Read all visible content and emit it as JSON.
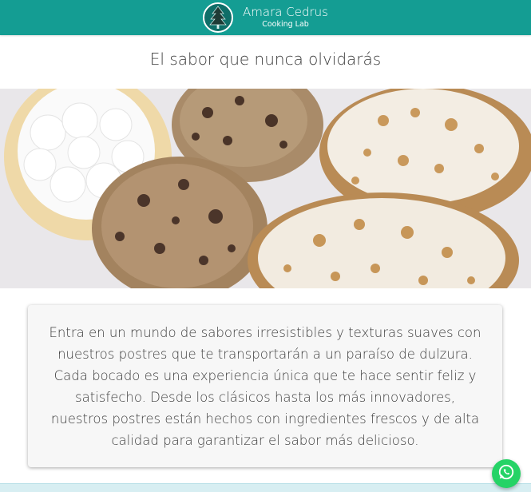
{
  "header": {
    "brand_name": "Amara Cedrus",
    "brand_subtitle": "Cooking Lab",
    "logo_icon": "cedar-tree-icon",
    "background_color": "#149d93"
  },
  "hero": {
    "title": "El sabor que nunca olvidarás",
    "image_subject": "pastries"
  },
  "intro": {
    "text": "Entra en un mundo de sabores irresistibles y texturas suaves con nuestros postres que te transportarán a un paraíso de dulzura. Cada bocado es una experiencia única que te hace sentir feliz y satisfecho. Desde los clásicos hasta los más innovadores, nuestros postres están hechos con ingredientes frescos y de alta calidad para garantizar el sabor más delicioso."
  },
  "floating": {
    "icon": "whatsapp-icon",
    "color": "#25d366"
  }
}
